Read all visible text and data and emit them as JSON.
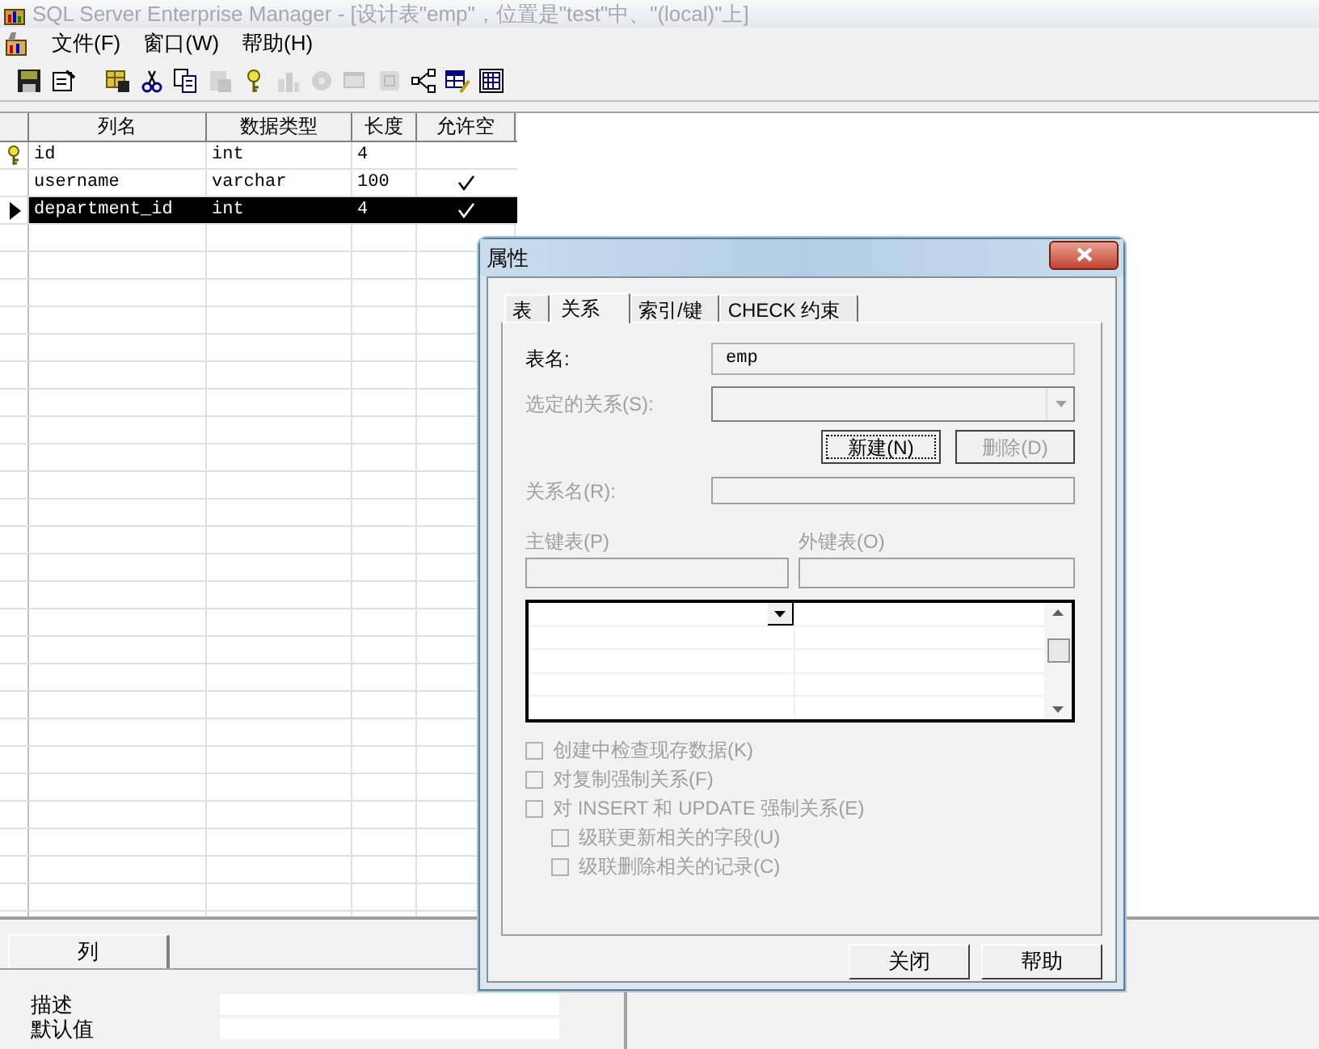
{
  "window": {
    "title": "SQL Server Enterprise Manager - [设计表\"emp\"，位置是\"test\"中、\"(local)\"上]"
  },
  "menu": [
    {
      "label": "文件(F)"
    },
    {
      "label": "窗口(W)"
    },
    {
      "label": "帮助(H)"
    }
  ],
  "toolbar": [
    {
      "kind": "save",
      "disabled": false
    },
    {
      "kind": "properties",
      "disabled": false
    },
    {
      "kind": "gap"
    },
    {
      "kind": "tablesave",
      "disabled": false
    },
    {
      "kind": "cut",
      "disabled": false
    },
    {
      "kind": "copy",
      "disabled": false
    },
    {
      "kind": "paste",
      "disabled": true
    },
    {
      "kind": "key",
      "disabled": false
    },
    {
      "kind": "chart",
      "disabled": true
    },
    {
      "kind": "gear",
      "disabled": true
    },
    {
      "kind": "window",
      "disabled": true
    },
    {
      "kind": "grid",
      "disabled": true
    },
    {
      "kind": "relations",
      "disabled": false
    },
    {
      "kind": "tableedit",
      "disabled": false
    },
    {
      "kind": "tablegrid",
      "disabled": false
    }
  ],
  "table": {
    "columns": [
      "列名",
      "数据类型",
      "长度",
      "允许空"
    ],
    "rows": [
      {
        "name": "id",
        "type": "int",
        "length": "4",
        "allow_null": false,
        "primary_key": true,
        "selected": false
      },
      {
        "name": "username",
        "type": "varchar",
        "length": "100",
        "allow_null": true,
        "primary_key": false,
        "selected": false
      },
      {
        "name": "department_id",
        "type": "int",
        "length": "4",
        "allow_null": true,
        "primary_key": false,
        "selected": true
      }
    ]
  },
  "column_panel": {
    "tabs": [
      {
        "label": "列",
        "selected": true
      }
    ],
    "properties": [
      {
        "label": "描述"
      },
      {
        "label": "默认值"
      }
    ]
  },
  "dialog": {
    "title": "属性",
    "tabs": [
      {
        "label": "表",
        "selected": false
      },
      {
        "label": "关系",
        "selected": true
      },
      {
        "label": "索引/键",
        "selected": false
      },
      {
        "label": "CHECK 约束",
        "selected": false
      }
    ],
    "table_name": {
      "label": "表名:",
      "value": "emp"
    },
    "selected_relationship": {
      "label": "选定的关系(S):",
      "disabled": true
    },
    "buttons": [
      {
        "label": "新建(N)",
        "disabled": false
      },
      {
        "label": "删除(D)",
        "disabled": true
      }
    ],
    "relationship_name": {
      "label": "关系名(R):",
      "disabled": true
    },
    "primary_key_table": {
      "label": "主键表(P)",
      "disabled": true
    },
    "foreign_key_table": {
      "label": "外键表(O)",
      "disabled": true
    },
    "options": [
      {
        "label": "创建中检查现存数据(K)",
        "checked": false,
        "disabled": true
      },
      {
        "label": "对复制强制关系(F)",
        "checked": false,
        "disabled": true
      },
      {
        "label": "对 INSERT 和 UPDATE 强制关系(E)",
        "checked": false,
        "disabled": true,
        "children": [
          {
            "label": "级联更新相关的字段(U)",
            "checked": false,
            "disabled": true
          },
          {
            "label": "级联删除相关的记录(C)",
            "checked": false,
            "disabled": true
          }
        ]
      }
    ],
    "footer_buttons": [
      {
        "label": "关闭"
      },
      {
        "label": "帮助"
      }
    ]
  }
}
